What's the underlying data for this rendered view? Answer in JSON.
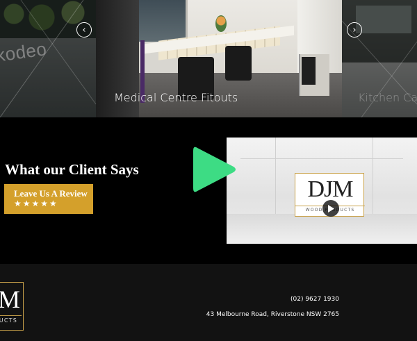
{
  "carousel": {
    "slides": [
      {
        "caption": ""
      },
      {
        "caption": "Medical Centre  Fitouts"
      },
      {
        "caption": "Kitchen Ca"
      }
    ],
    "left_slide_sign": "kodeo",
    "prev_arrow_glyph": "‹",
    "next_arrow_glyph": "›",
    "prev_icon": "chevron-left-icon",
    "next_icon": "chevron-right-icon"
  },
  "testimonials": {
    "heading": "What our Client Says",
    "review_button": {
      "label": "Leave Us A Review",
      "stars": "★★★★★",
      "rating": 5
    },
    "play_icon": "play-icon",
    "video": {
      "logo_mark": "DJM",
      "logo_brand": "WOOD PRODUCTS"
    }
  },
  "footer": {
    "logo_mark": "M",
    "logo_brand": "UCTS",
    "phone": "(02) 9627 1930",
    "address": "43 Melbourne Road, Riverstone NSW 2765"
  },
  "colors": {
    "accent_gold": "#d4a02b",
    "play_green": "#3ddc84",
    "footer_bg": "#121212",
    "page_bg": "#000000"
  }
}
